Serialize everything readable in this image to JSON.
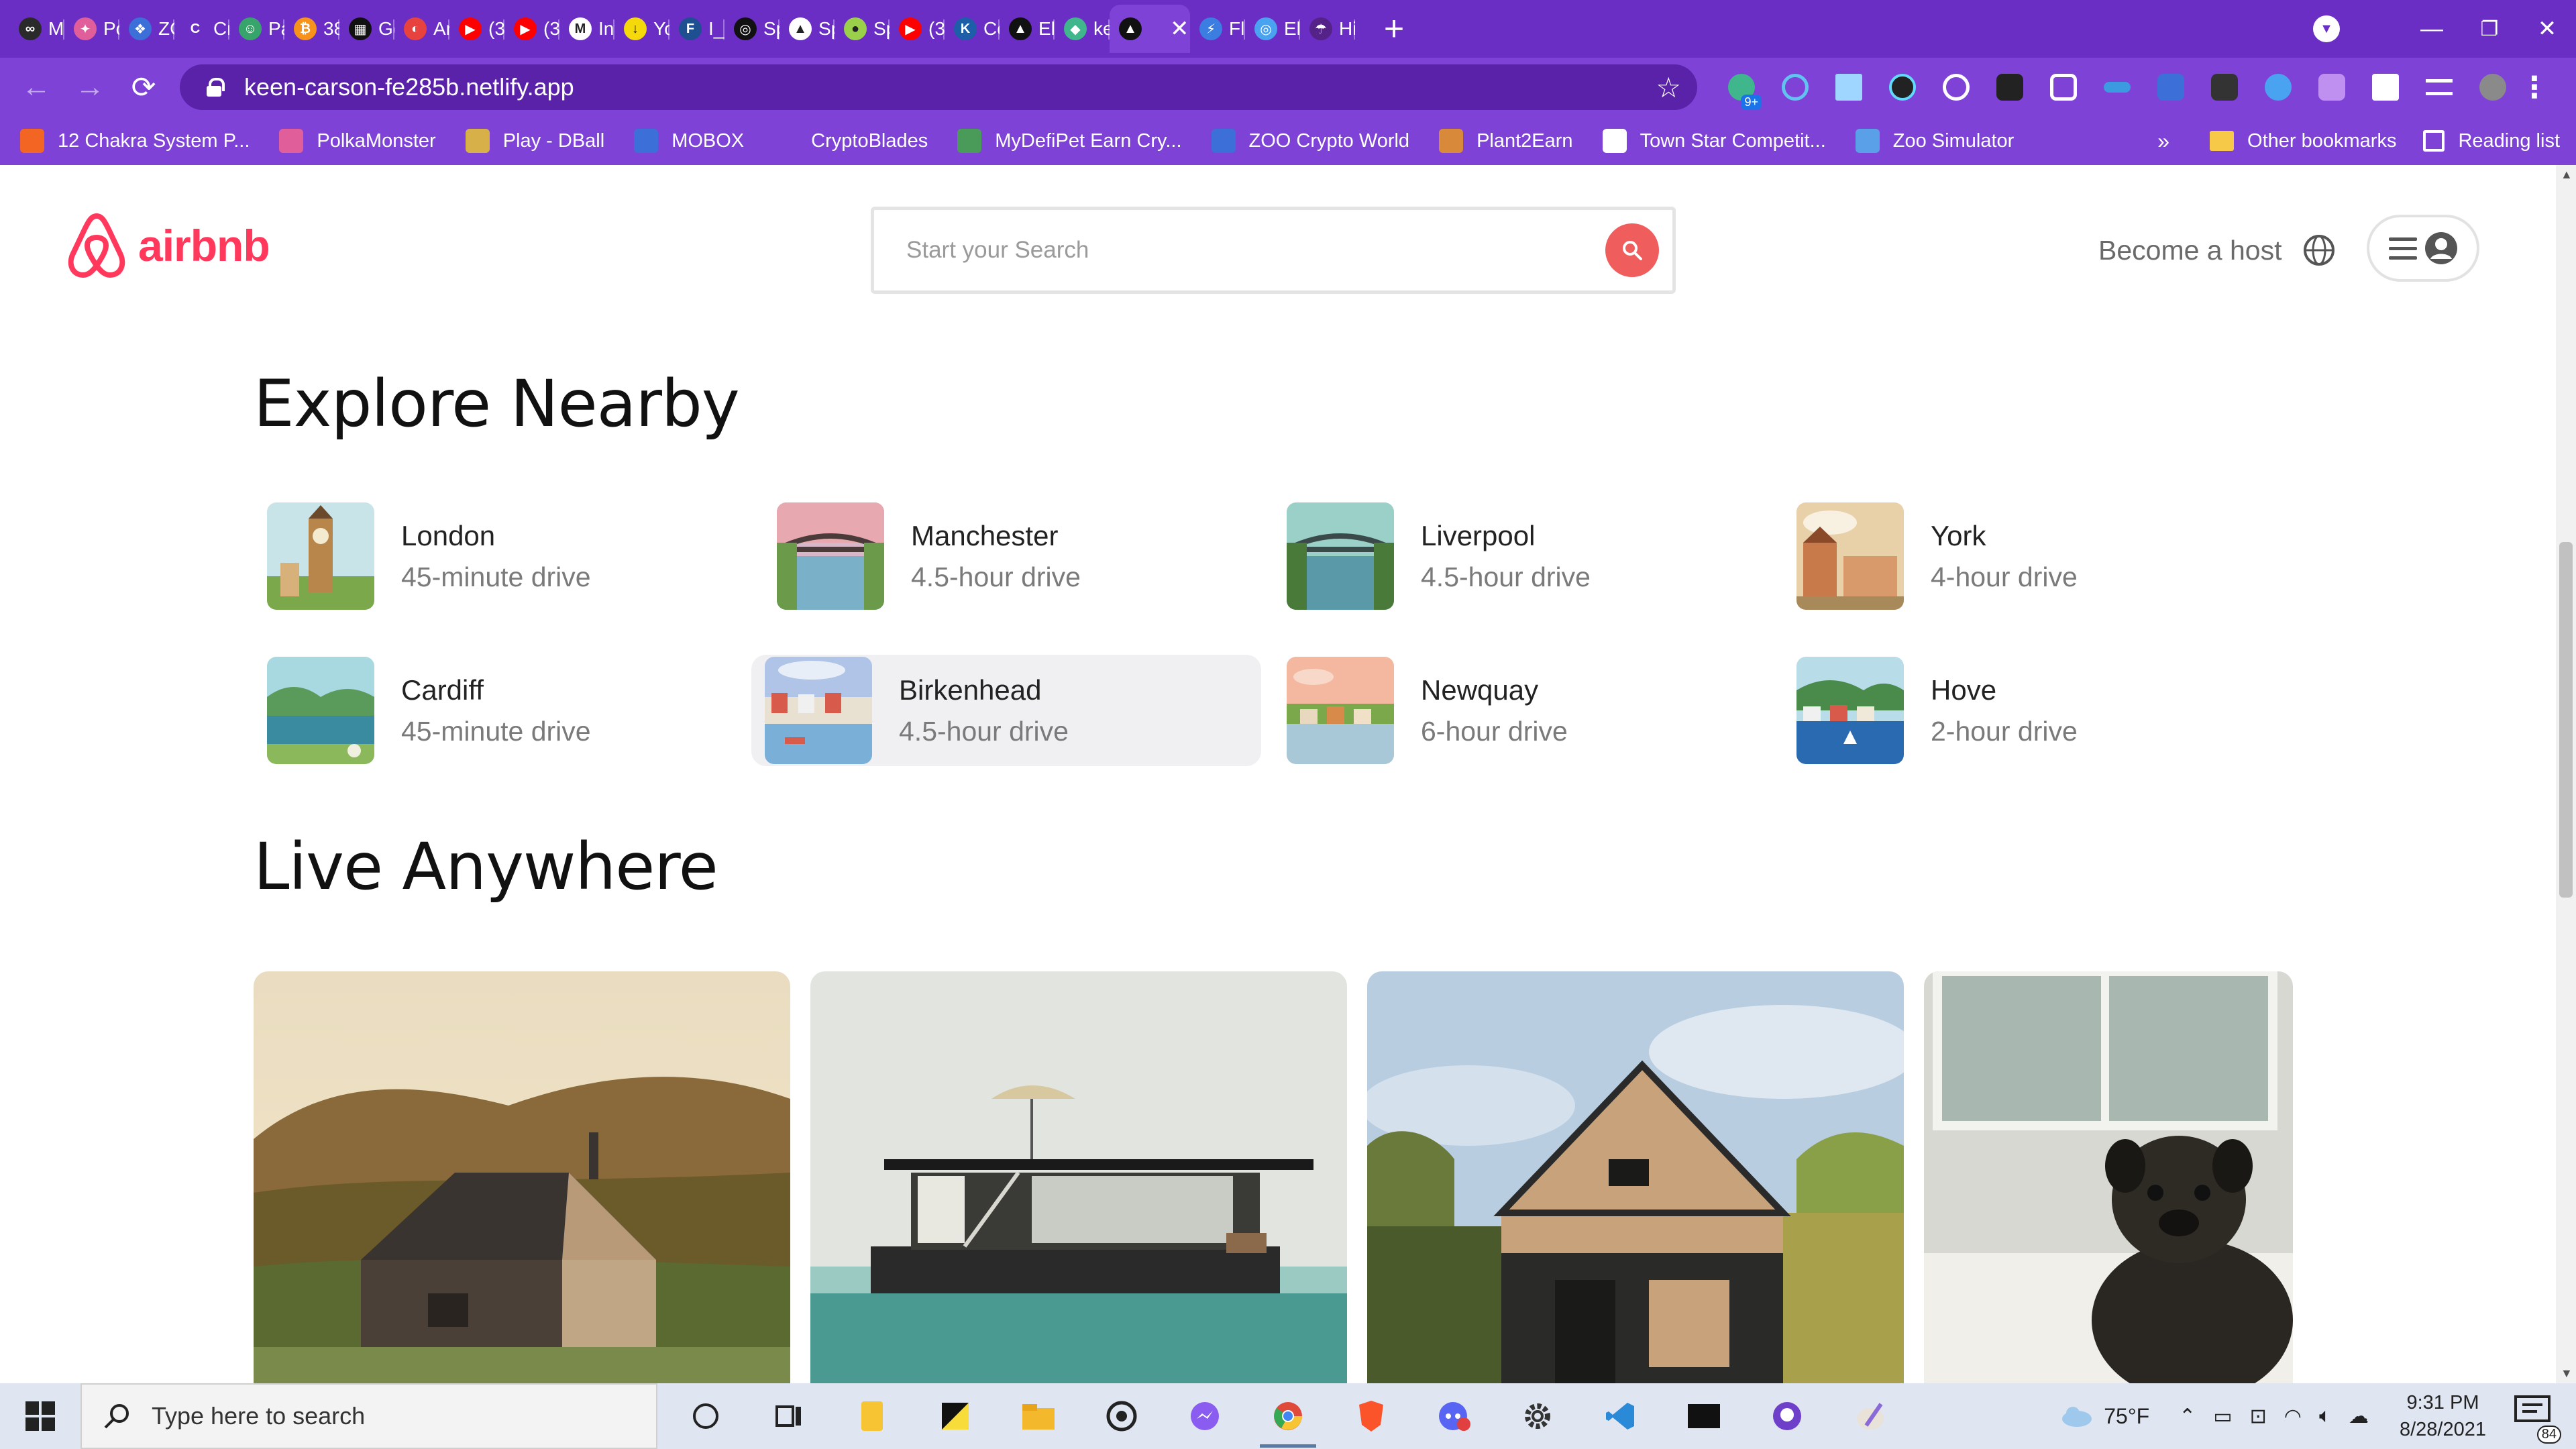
{
  "browser": {
    "tabs": [
      {
        "title": "Mi",
        "color": "#2a2a2a",
        "glyph": "∞"
      },
      {
        "title": "Po",
        "color": "#e05f9a",
        "glyph": "✦"
      },
      {
        "title": "ZC",
        "color": "#3c6fd8",
        "glyph": "❖"
      },
      {
        "title": "Cr",
        "color": "#6a2ec4",
        "glyph": "C"
      },
      {
        "title": "Pa",
        "color": "#37a46b",
        "glyph": "☺"
      },
      {
        "title": "38",
        "color": "#f7931a",
        "glyph": "₿"
      },
      {
        "title": "Gc",
        "color": "#111111",
        "glyph": "▦"
      },
      {
        "title": "Ar",
        "color": "#e8423f",
        "glyph": "◐"
      },
      {
        "title": "(3",
        "color": "#ff0000",
        "glyph": "▶"
      },
      {
        "title": "(3",
        "color": "#ff0000",
        "glyph": "▶"
      },
      {
        "title": "Int",
        "color": "#ffffff",
        "glyph": "M"
      },
      {
        "title": "Yo",
        "color": "#f5d90a",
        "glyph": "↓"
      },
      {
        "title": "I_D",
        "color": "#1d4f91",
        "glyph": "F"
      },
      {
        "title": "Sp",
        "color": "#111111",
        "glyph": "◎"
      },
      {
        "title": "Sp",
        "color": "#ffffff",
        "glyph": "▲"
      },
      {
        "title": "Sp",
        "color": "#9bd14a",
        "glyph": "●"
      },
      {
        "title": "(3",
        "color": "#ff0000",
        "glyph": "▶"
      },
      {
        "title": "Co",
        "color": "#1c5fa8",
        "glyph": "K"
      },
      {
        "title": "Eli",
        "color": "#111111",
        "glyph": "▲"
      },
      {
        "title": "ke",
        "color": "#3fb68b",
        "glyph": "◆"
      },
      {
        "title": "",
        "color": "#111111",
        "glyph": "▲",
        "active": true
      },
      {
        "title": "Fle",
        "color": "#3b7de0",
        "glyph": "⚡"
      },
      {
        "title": "Eli",
        "color": "#4aa3f0",
        "glyph": "◎"
      },
      {
        "title": "Hi",
        "color": "#552288",
        "glyph": "☂"
      }
    ],
    "new_tab": "+",
    "tab_close": "✕",
    "url": "keen-carson-fe285b.netlify.app",
    "bookmarks": [
      {
        "label": "12 Chakra System P...",
        "color": "#f26522"
      },
      {
        "label": "PolkaMonster",
        "color": "#e05f9a"
      },
      {
        "label": "Play - DBall",
        "color": "#d8b04a"
      },
      {
        "label": "MOBOX",
        "color": "#3c6fd8"
      },
      {
        "label": "CryptoBlades",
        "color": "#7e43d6"
      },
      {
        "label": "MyDefiPet Earn Cry...",
        "color": "#4a9b5a"
      },
      {
        "label": "ZOO Crypto World",
        "color": "#3c6fd8"
      },
      {
        "label": "Plant2Earn",
        "color": "#d88a3a"
      },
      {
        "label": "Town Star Competit...",
        "color": "#ffffff"
      },
      {
        "label": "Zoo Simulator",
        "color": "#5aa0e8"
      }
    ],
    "bookmarks_more": "»",
    "other_bookmarks": "Other bookmarks",
    "reading_list": "Reading list",
    "extension_badge": "9+"
  },
  "airbnb": {
    "logo_text": "airbnb",
    "search_placeholder": "Start your Search",
    "become_host": "Become a host",
    "explore_title": "Explore Nearby",
    "live_title": "Live Anywhere",
    "nearby": [
      {
        "city": "London",
        "distance": "45-minute drive",
        "theme": "london"
      },
      {
        "city": "Manchester",
        "distance": "4.5-hour drive",
        "theme": "bridge"
      },
      {
        "city": "Liverpool",
        "distance": "4.5-hour drive",
        "theme": "bridge2"
      },
      {
        "city": "York",
        "distance": "4-hour drive",
        "theme": "town"
      },
      {
        "city": "Cardiff",
        "distance": "45-minute drive",
        "theme": "lake"
      },
      {
        "city": "Birkenhead",
        "distance": "4.5-hour drive",
        "theme": "harbour",
        "highlight": true
      },
      {
        "city": "Newquay",
        "distance": "6-hour drive",
        "theme": "sunset"
      },
      {
        "city": "Hove",
        "distance": "2-hour drive",
        "theme": "sea"
      }
    ],
    "live_photos": [
      {
        "subject": "wooden house on hillside"
      },
      {
        "subject": "floating houseboat"
      },
      {
        "subject": "a-frame cabin"
      },
      {
        "subject": "pug on bed"
      }
    ]
  },
  "taskbar": {
    "search_placeholder": "Type here to search",
    "temperature": "75°F",
    "time": "9:31 PM",
    "date": "8/28/2021",
    "notification_count": "84"
  }
}
